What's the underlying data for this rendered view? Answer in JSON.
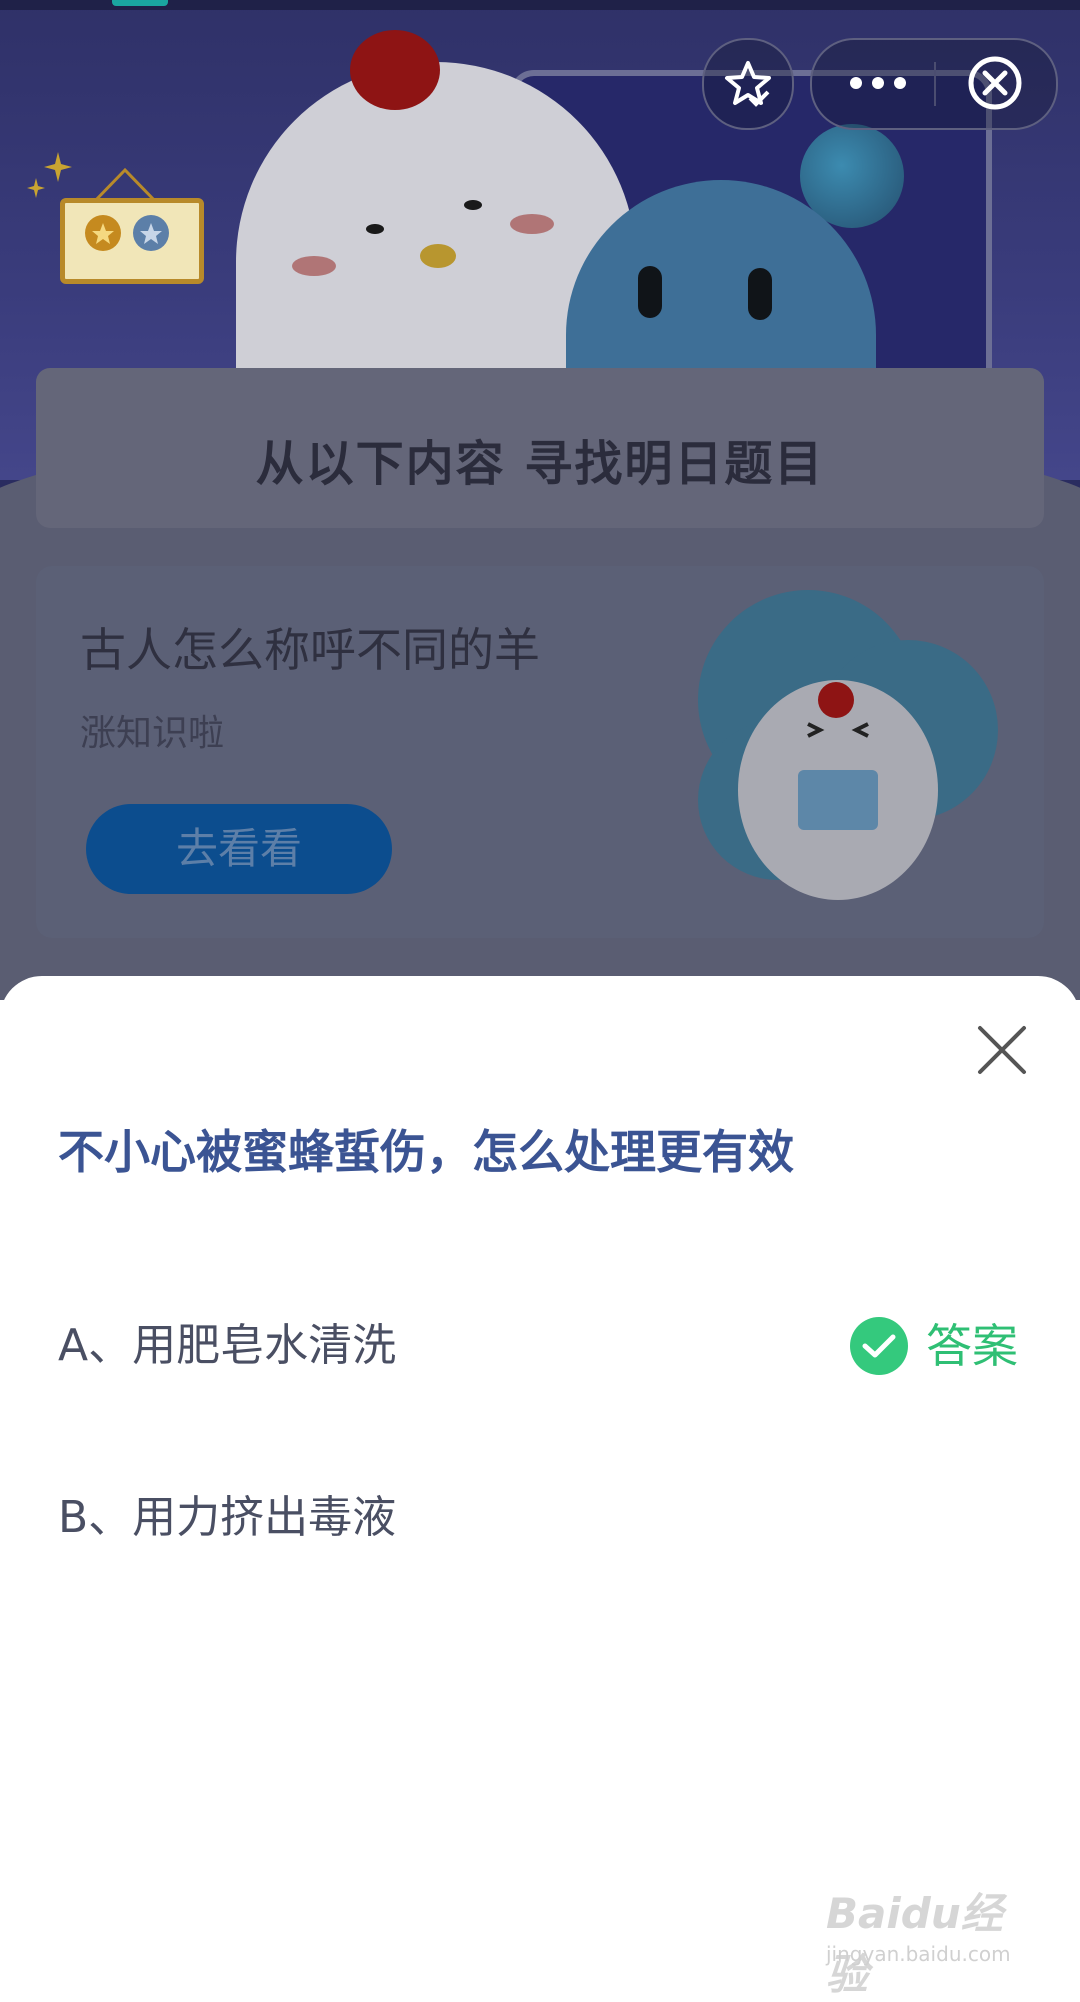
{
  "topbar": {
    "favorite_icon": "star-check-icon",
    "more_icon": "more-dots-icon",
    "close_icon": "close-circle-icon"
  },
  "hero": {
    "banner_title": "从以下内容  寻找明日题目"
  },
  "card": {
    "title": "古人怎么称呼不同的羊",
    "subtitle": "涨知识啦",
    "button_label": "去看看"
  },
  "quiz": {
    "question": "不小心被蜜蜂蜇伤，怎么处理更有效",
    "options": [
      {
        "label": "A、用肥皂水清洗",
        "is_answer": true
      },
      {
        "label": "B、用力挤出毒液",
        "is_answer": false
      }
    ],
    "answer_label": "答案"
  },
  "watermark": {
    "main": "Baidu经验",
    "sub": "jingyan.baidu.com"
  },
  "colors": {
    "question": "#3b5493",
    "answer_green": "#34c97d",
    "button_blue": "#0c4d8e"
  }
}
